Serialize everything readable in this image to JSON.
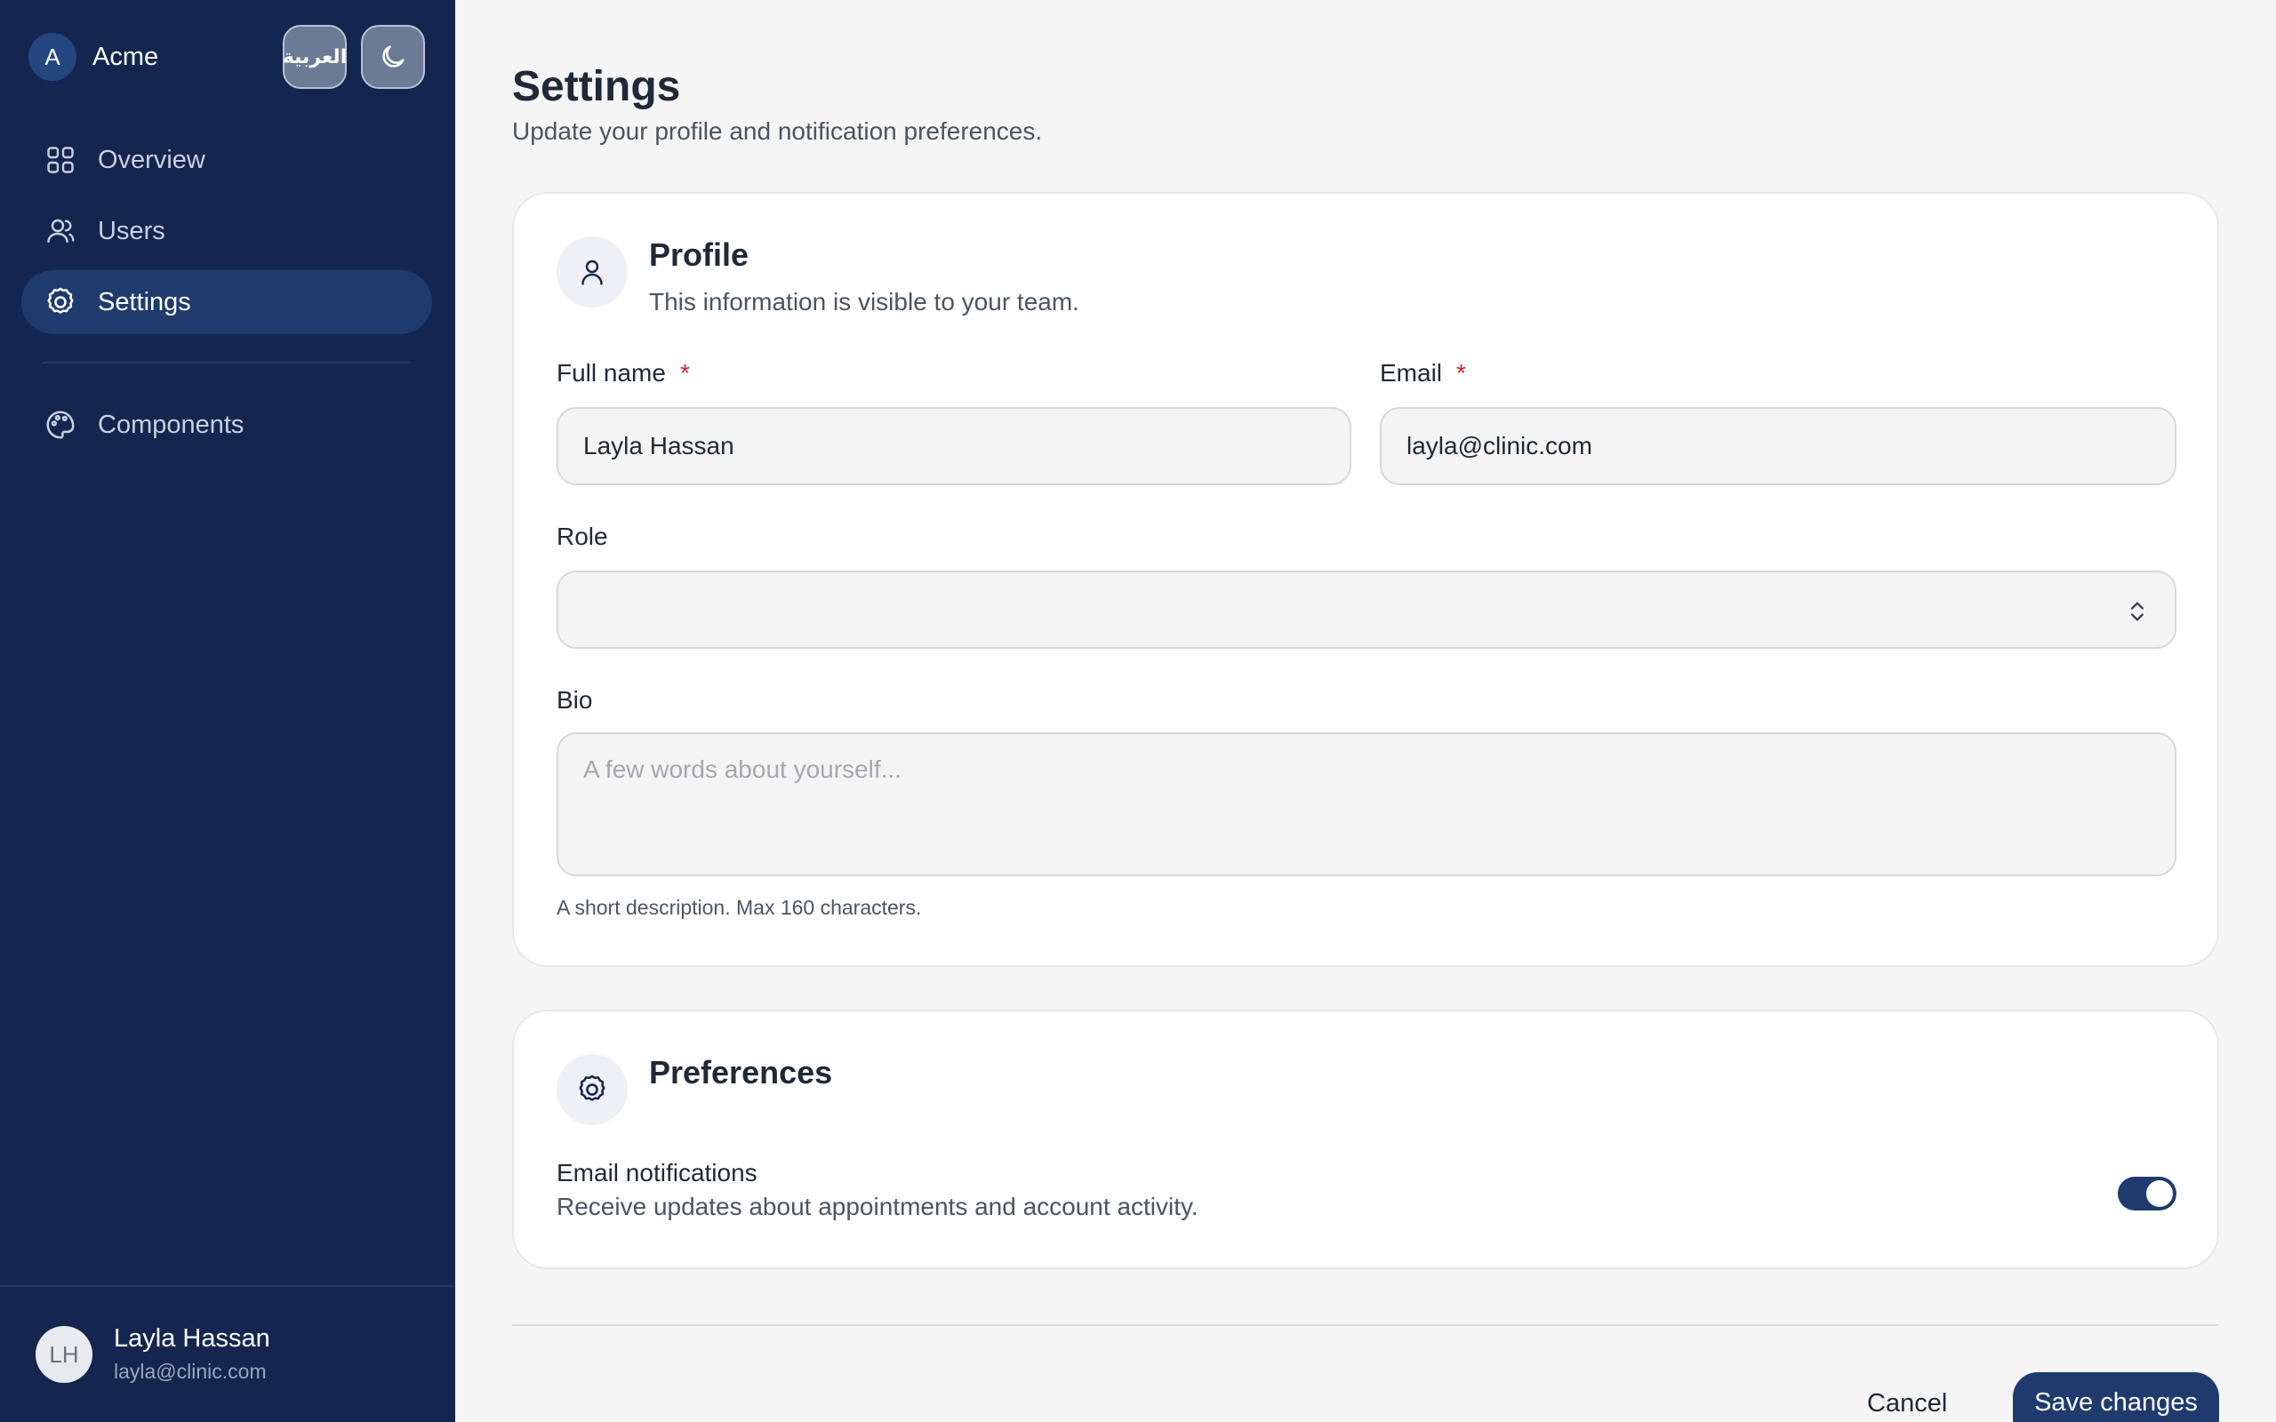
{
  "sidebar": {
    "brand": {
      "initial": "A",
      "name": "Acme"
    },
    "language_button": "العربية",
    "theme_icon": "moon-icon",
    "items": [
      {
        "label": "Overview",
        "icon": "grid-icon",
        "active": false
      },
      {
        "label": "Users",
        "icon": "users-icon",
        "active": false
      },
      {
        "label": "Settings",
        "icon": "gear-icon",
        "active": true
      },
      {
        "label": "Components",
        "icon": "palette-icon",
        "active": false
      }
    ],
    "user": {
      "initials": "LH",
      "name": "Layla Hassan",
      "email": "layla@clinic.com"
    }
  },
  "page": {
    "title": "Settings",
    "subtitle": "Update your profile and notification preferences."
  },
  "profile": {
    "title": "Profile",
    "description": "This information is visible to your team.",
    "full_name": {
      "label": "Full name",
      "required_mark": "*",
      "value": "Layla Hassan"
    },
    "email": {
      "label": "Email",
      "required_mark": "*",
      "value": "layla@clinic.com"
    },
    "role": {
      "label": "Role",
      "value": ""
    },
    "bio": {
      "label": "Bio",
      "placeholder": "A few words about yourself...",
      "hint": "A short description. Max 160 characters."
    }
  },
  "preferences": {
    "title": "Preferences",
    "email_notifications": {
      "label": "Email notifications",
      "description": "Receive updates about appointments and account activity.",
      "enabled": true
    }
  },
  "actions": {
    "cancel": "Cancel",
    "save": "Save changes"
  },
  "colors": {
    "sidebar_bg": "#14264f",
    "accent": "#1f3b6e",
    "required": "#c0262d"
  }
}
